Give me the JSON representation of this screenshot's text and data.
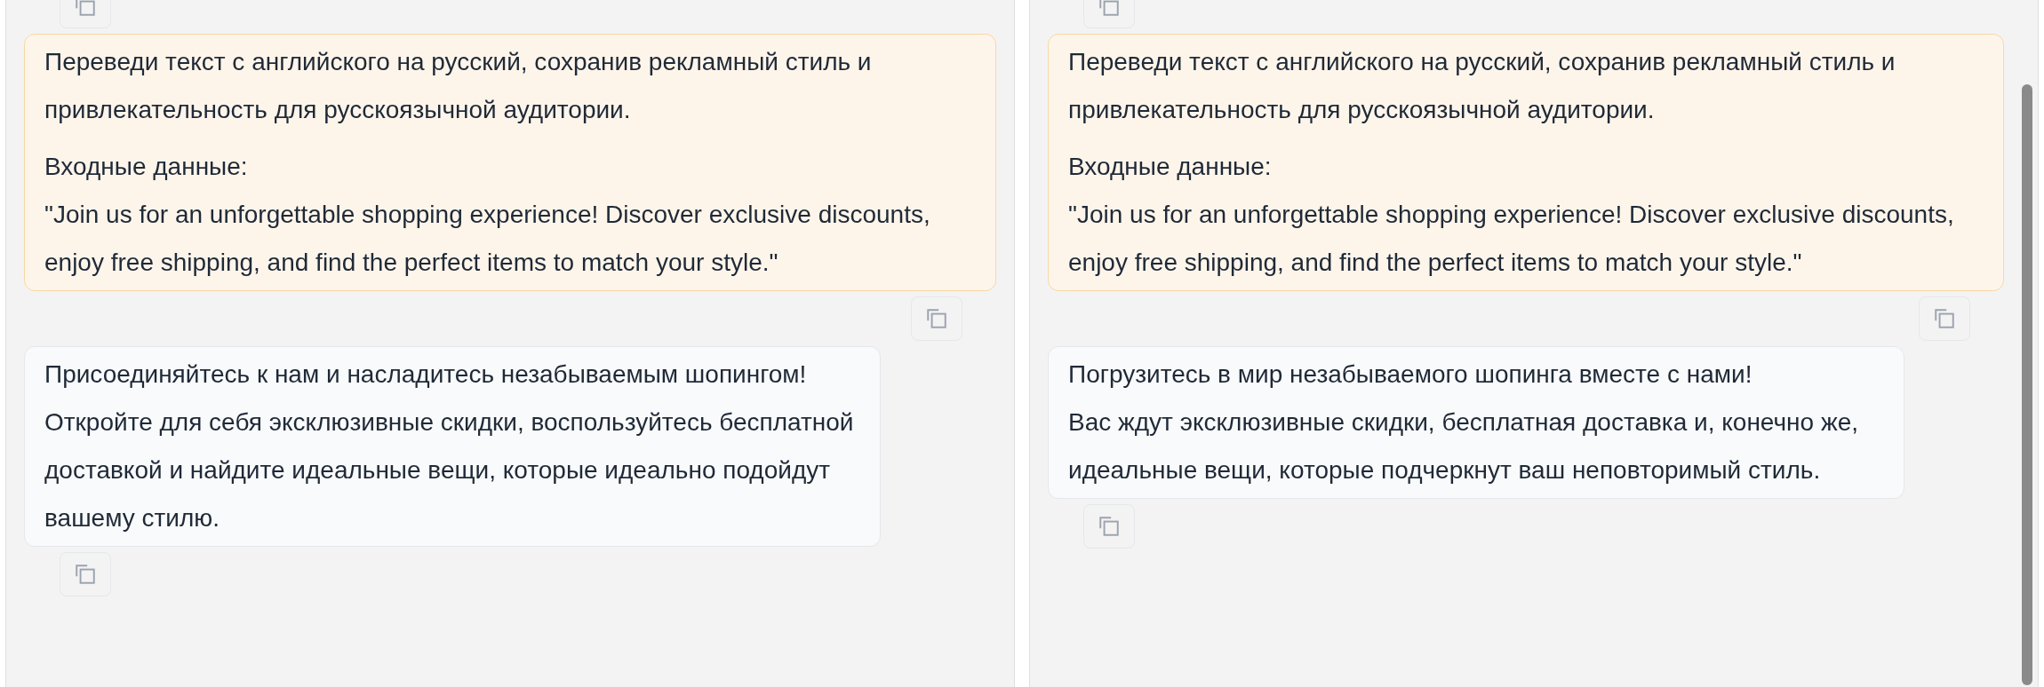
{
  "panels": [
    {
      "messages": [
        {
          "kind": "user",
          "paragraphs": [
            "Переведи текст с английского на русский, сохранив рекламный стиль и привлекательность для русскоязычной аудитории.",
            "Входные данные:\n\"Join us for an unforgettable shopping experience! Discover exclusive discounts, enjoy free shipping, and find the perfect items to match your style.\""
          ]
        },
        {
          "kind": "assistant",
          "paragraphs": [
            "Присоединяйтесь к нам и насладитесь незабываемым шопингом! Откройте для себя эксклюзивные скидки, воспользуйтесь бесплатной доставкой и найдите идеальные вещи, которые идеально подойдут вашему стилю."
          ]
        }
      ]
    },
    {
      "messages": [
        {
          "kind": "user",
          "paragraphs": [
            "Переведи текст с английского на русский, сохранив рекламный стиль и привлекательность для русскоязычной аудитории.",
            "Входные данные:\n\"Join us for an unforgettable shopping experience! Discover exclusive discounts, enjoy free shipping, and find the perfect items to match your style.\""
          ]
        },
        {
          "kind": "assistant",
          "paragraphs": [
            "Погрузитесь в мир незабываемого шопинга вместе с нами!\nВас ждут эксклюзивные скидки, бесплатная доставка и, конечно же, идеальные вещи, которые подчеркнут ваш неповторимый стиль."
          ]
        }
      ]
    }
  ]
}
